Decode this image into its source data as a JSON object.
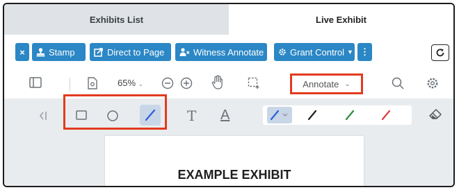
{
  "tabs": [
    {
      "label": "Exhibits List"
    },
    {
      "label": "Live Exhibit"
    }
  ],
  "actions": {
    "close_label": "×",
    "stamp_label": "Stamp",
    "direct_label": "Direct to Page",
    "witness_label": "Witness Annotate",
    "grant_label": "Grant Control",
    "more_label": "⋮"
  },
  "viewer": {
    "zoom": "65%",
    "mode": "Annotate"
  },
  "annotation": {
    "text_tool": "T",
    "underline_tool": "A",
    "colors": [
      "#2b5fd9",
      "#1e1e1e",
      "#2e8b3a",
      "#e23a3a"
    ]
  },
  "document": {
    "title": "EXAMPLE EXHIBIT"
  },
  "accent_color": "#2b87c5",
  "highlight_color": "#e23a1e"
}
